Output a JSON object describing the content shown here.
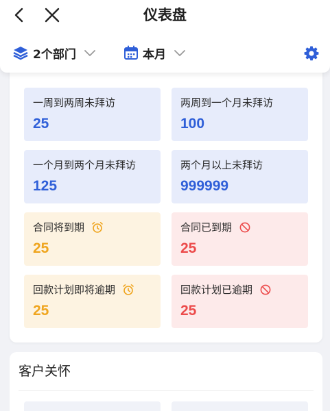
{
  "header": {
    "title": "仪表盘",
    "department_filter": "2个部门",
    "period_filter": "本月"
  },
  "stats": [
    {
      "label": "一周到两周未拜访",
      "value": "25",
      "tone": "blue",
      "badge": ""
    },
    {
      "label": "两周到一个月未拜访",
      "value": "100",
      "tone": "blue",
      "badge": ""
    },
    {
      "label": "一个月到两个月未拜访",
      "value": "125",
      "tone": "blue",
      "badge": ""
    },
    {
      "label": "两个月以上未拜访",
      "value": "999999",
      "tone": "blue",
      "badge": ""
    },
    {
      "label": "合同将到期",
      "value": "25",
      "tone": "yellow",
      "badge": "alarm-clock-icon"
    },
    {
      "label": "合同已到期",
      "value": "25",
      "tone": "red",
      "badge": "prohibited-icon"
    },
    {
      "label": "回款计划即将逾期",
      "value": "25",
      "tone": "yellow",
      "badge": "alarm-clock-icon"
    },
    {
      "label": "回款计划已逾期",
      "value": "25",
      "tone": "red",
      "badge": "prohibited-icon"
    }
  ],
  "care_section": {
    "title": "客户关怀"
  },
  "colors": {
    "accent_blue": "#2f5fd8",
    "warning_yellow": "#efa51f",
    "danger_red": "#ec4b4b",
    "tile_blue_bg": "#e7ecfb",
    "tile_yellow_bg": "#fdf3e1",
    "tile_red_bg": "#fdeaea"
  }
}
